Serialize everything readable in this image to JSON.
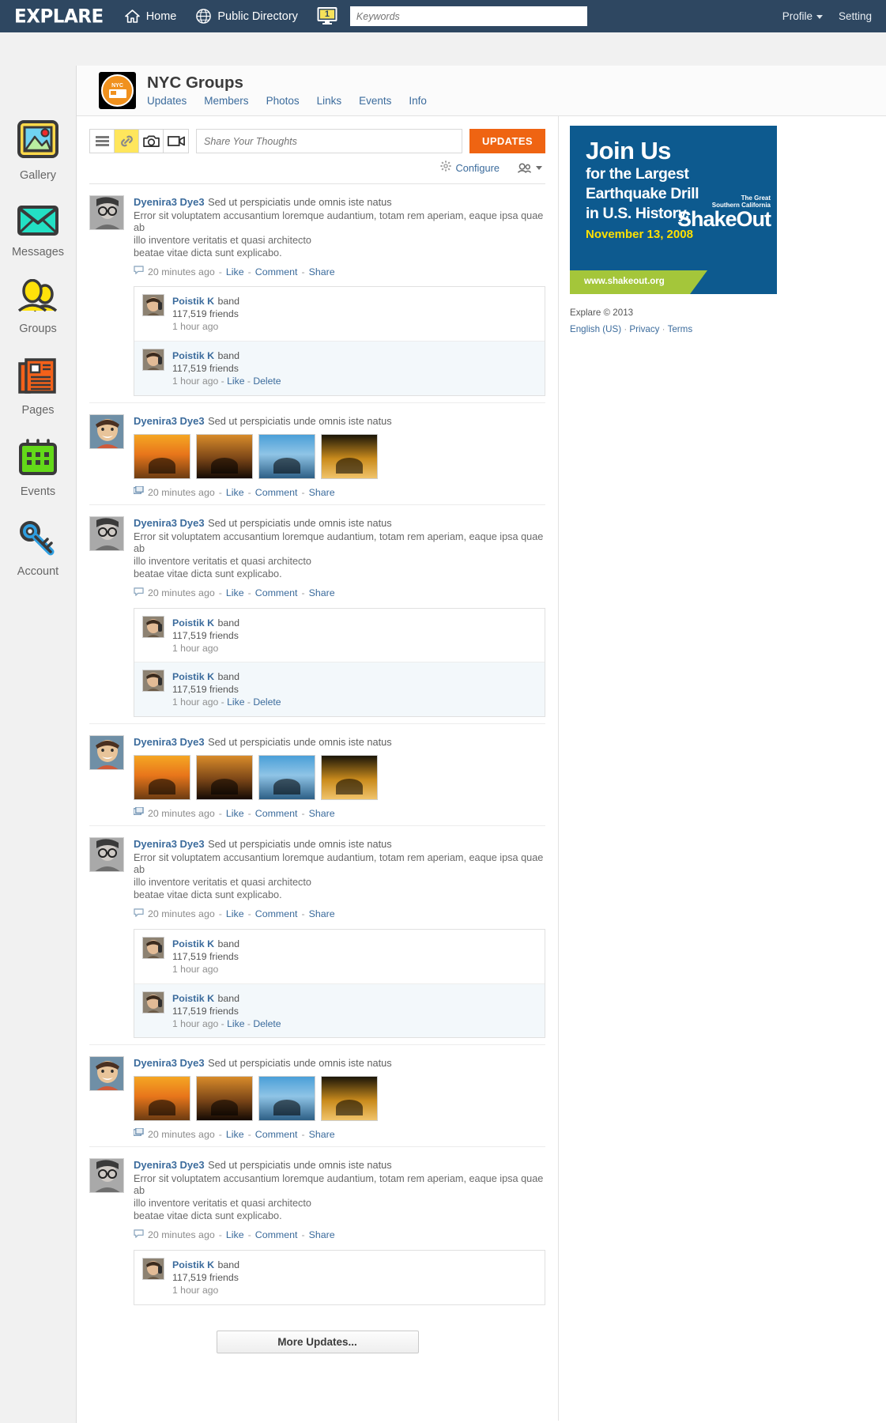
{
  "topbar": {
    "brand": "EXPLARE",
    "nav": [
      {
        "label": "Home",
        "icon": "home-icon"
      },
      {
        "label": "Public Directory",
        "icon": "globe-icon"
      }
    ],
    "notification_count": "1",
    "search_placeholder": "Keywords",
    "right": [
      {
        "label": "Profile",
        "has_caret": true
      },
      {
        "label": "Setting",
        "has_caret": false
      }
    ],
    "bg_color": "#2e4761"
  },
  "rail": [
    {
      "label": "Gallery",
      "icon": "gallery-icon",
      "color": "#ffd94a"
    },
    {
      "label": "Messages",
      "icon": "envelope-icon",
      "color": "#23e0c4"
    },
    {
      "label": "Groups",
      "icon": "people-icon",
      "color": "#ffe10a"
    },
    {
      "label": "Pages",
      "icon": "newspaper-icon",
      "color": "#f4611a"
    },
    {
      "label": "Events",
      "icon": "calendar-icon",
      "color": "#63d919"
    },
    {
      "label": "Account",
      "icon": "key-icon",
      "color": "#2e9ee0"
    }
  ],
  "group": {
    "logo_text": "NYC",
    "title": "NYC Groups",
    "tabs": [
      "Updates",
      "Members",
      "Photos",
      "Links",
      "Events",
      "Info"
    ]
  },
  "composer": {
    "tools": [
      {
        "name": "list-icon",
        "active": false
      },
      {
        "name": "link-icon",
        "active": true
      },
      {
        "name": "camera-icon",
        "active": false
      },
      {
        "name": "video-icon",
        "active": false
      }
    ],
    "placeholder": "Share Your Thoughts",
    "submit_label": "UPDATES",
    "configure_label": "Configure",
    "accent_color": "#ef6412"
  },
  "comment_sample": {
    "name": "Poistik K",
    "role": "band",
    "friends": "117,519 friends",
    "time": "1 hour ago",
    "like": "Like",
    "delete": "Delete",
    "dash": "-"
  },
  "posts": [
    {
      "type": "text",
      "name": "Dyenira3 Dye3",
      "headline": "Sed ut perspiciatis unde omnis iste natus",
      "line1": "Error sit voluptatem accusantium loremque audantium, totam rem aperiam, eaque ipsa quae ab",
      "line2": "illo inventore veritatis et quasi architecto",
      "line3": "beatae vitae dicta sunt explicabo.",
      "time": "20 minutes ago",
      "actions": [
        "Like",
        "Comment",
        "Share"
      ],
      "comments": [
        {
          "with_actions": false
        },
        {
          "with_actions": true
        }
      ]
    },
    {
      "type": "photos",
      "name": "Dyenira3 Dye3",
      "headline": "Sed ut perspiciatis unde omnis iste natus",
      "time": "20 minutes ago",
      "actions": [
        "Like",
        "Comment",
        "Share"
      ],
      "photo_count": 4
    },
    {
      "type": "text",
      "name": "Dyenira3 Dye3",
      "headline": "Sed ut perspiciatis unde omnis iste natus",
      "line1": "Error sit voluptatem accusantium loremque audantium, totam rem aperiam, eaque ipsa quae ab",
      "line2": "illo inventore veritatis et quasi architecto",
      "line3": "beatae vitae dicta sunt explicabo.",
      "time": "20 minutes ago",
      "actions": [
        "Like",
        "Comment",
        "Share"
      ],
      "comments": [
        {
          "with_actions": false
        },
        {
          "with_actions": true
        }
      ]
    },
    {
      "type": "photos",
      "name": "Dyenira3 Dye3",
      "headline": "Sed ut perspiciatis unde omnis iste natus",
      "time": "20 minutes ago",
      "actions": [
        "Like",
        "Comment",
        "Share"
      ],
      "photo_count": 4
    },
    {
      "type": "text",
      "name": "Dyenira3 Dye3",
      "headline": "Sed ut perspiciatis unde omnis iste natus",
      "line1": "Error sit voluptatem accusantium loremque audantium, totam rem aperiam, eaque ipsa quae ab",
      "line2": "illo inventore veritatis et quasi architecto",
      "line3": "beatae vitae dicta sunt explicabo.",
      "time": "20 minutes ago",
      "actions": [
        "Like",
        "Comment",
        "Share"
      ],
      "comments": [
        {
          "with_actions": false
        },
        {
          "with_actions": true
        }
      ]
    },
    {
      "type": "photos",
      "name": "Dyenira3 Dye3",
      "headline": "Sed ut perspiciatis unde omnis iste natus",
      "time": "20 minutes ago",
      "actions": [
        "Like",
        "Comment",
        "Share"
      ],
      "photo_count": 4
    },
    {
      "type": "text",
      "name": "Dyenira3 Dye3",
      "headline": "Sed ut perspiciatis unde omnis iste natus",
      "line1": "Error sit voluptatem accusantium loremque audantium, totam rem aperiam, eaque ipsa quae ab",
      "line2": "illo inventore veritatis et quasi architecto",
      "line3": "beatae vitae dicta sunt explicabo.",
      "time": "20 minutes ago",
      "actions": [
        "Like",
        "Comment",
        "Share"
      ],
      "comments": [
        {
          "with_actions": false
        }
      ]
    }
  ],
  "more_button": "More Updates...",
  "ad": {
    "line1": "Join Us",
    "line2": "for the Largest",
    "line3": "Earthquake Drill",
    "line4": "in U.S. History.",
    "date": "November 13, 2008",
    "url": "www.shakeout.org",
    "sponsor_small": "The Great",
    "sponsor_small2": "Southern California",
    "sponsor_a": "ShakeOut",
    "bg": "#0d5a8f",
    "strip": "#a4c63a",
    "date_color": "#ffe000"
  },
  "footer": {
    "copyright": "Explare © 2013",
    "lang": "English (US)",
    "links": [
      "Privacy",
      "Terms"
    ],
    "sep": "·"
  }
}
